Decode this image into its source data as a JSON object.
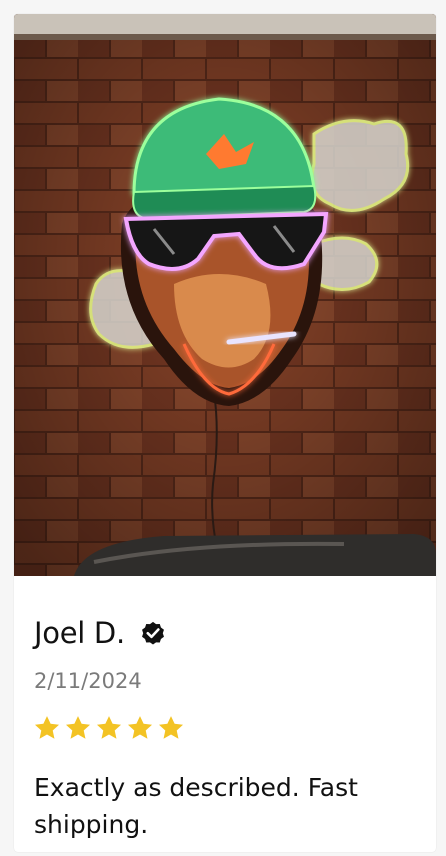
{
  "review": {
    "author": "Joel D.",
    "verified_icon": "check-badge-icon",
    "date": "2/11/2024",
    "rating": 5,
    "rating_max": 5,
    "star_color": "#f3c324",
    "text": "Exactly as described. Fast shipping."
  },
  "photo": {
    "subject": "neon monkey sign with cap and sunglasses on brick wall",
    "colors": {
      "brick": "#7e3f26",
      "cap": "#2fa86a",
      "neon_pink": "#f4a0ff",
      "neon_yellow": "#f4ff9a"
    }
  }
}
